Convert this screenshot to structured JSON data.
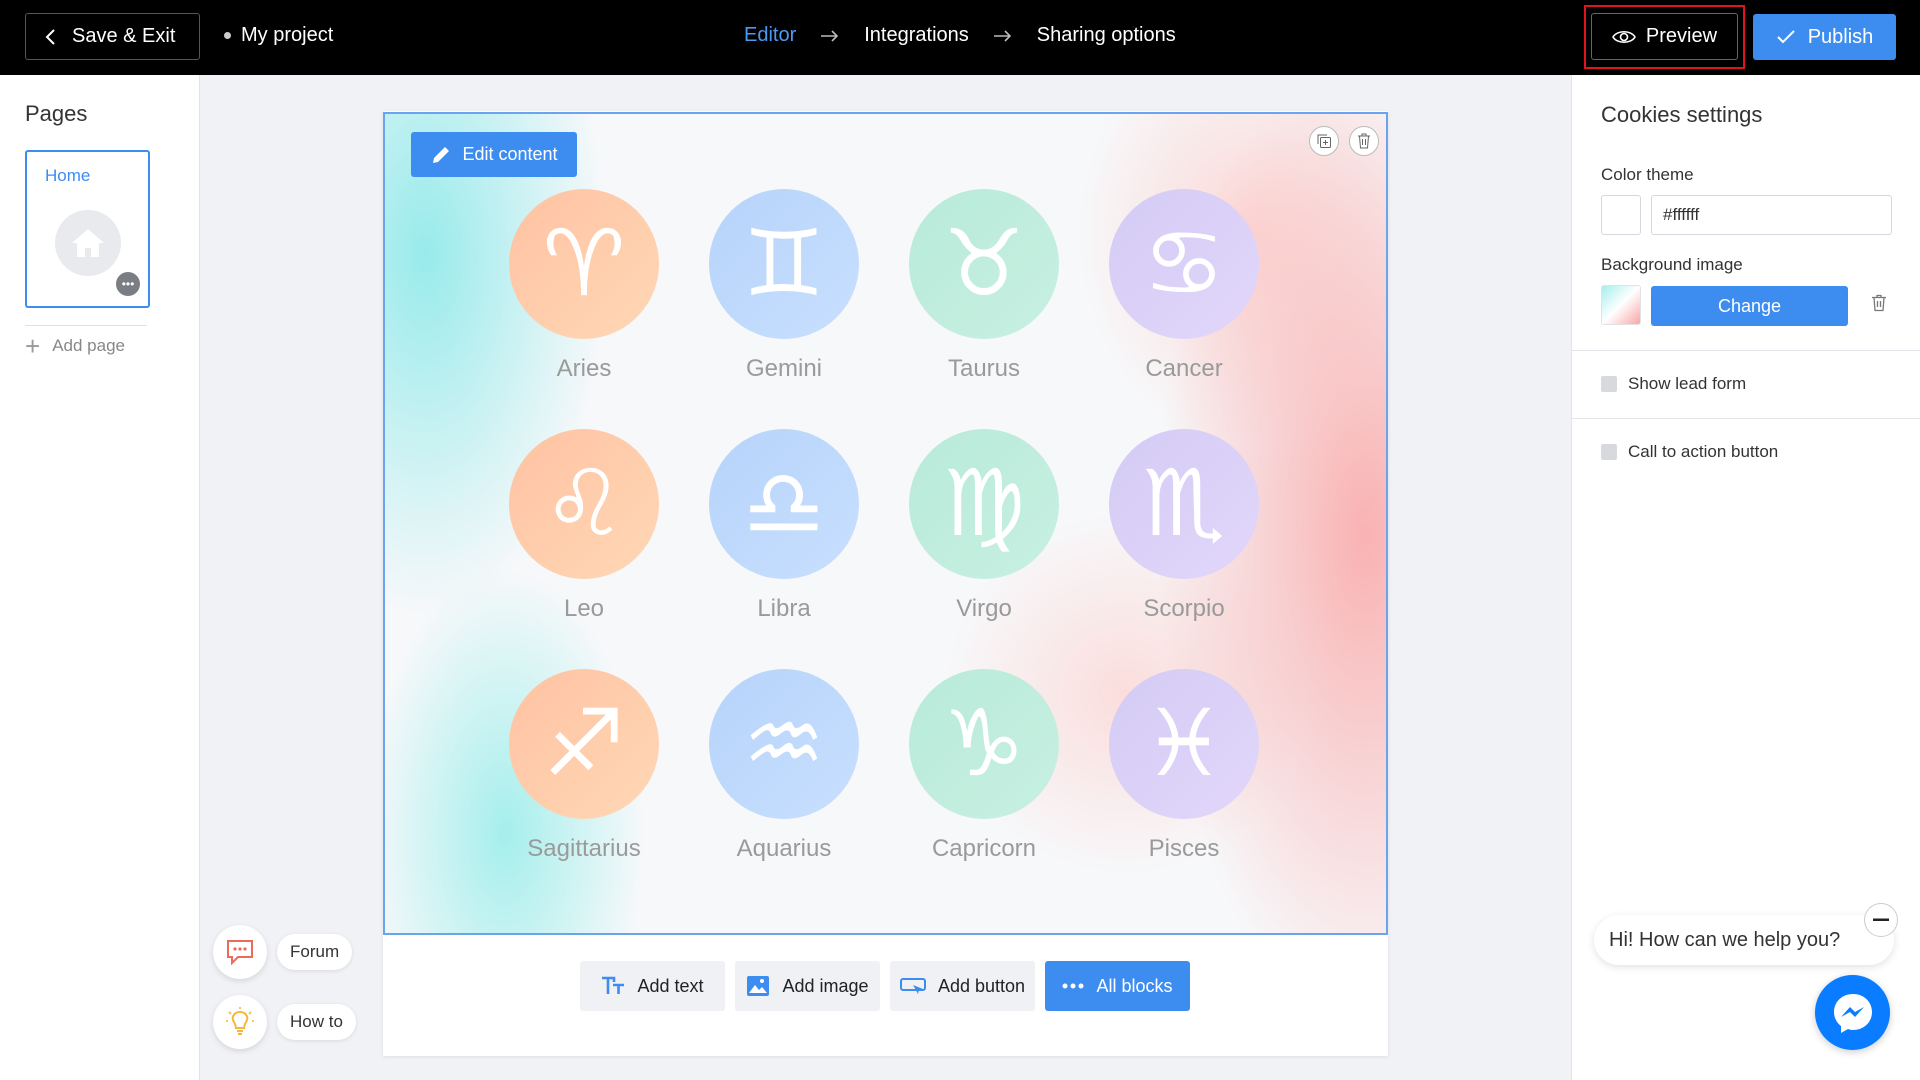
{
  "topbar": {
    "save_exit_label": "Save & Exit",
    "project_name": "My project",
    "steps": [
      "Editor",
      "Integrations",
      "Sharing options"
    ],
    "preview_label": "Preview",
    "publish_label": "Publish"
  },
  "pages": {
    "title": "Pages",
    "items": [
      {
        "label": "Home"
      }
    ],
    "add_page_label": "Add page"
  },
  "help": {
    "forum_label": "Forum",
    "howto_label": "How to"
  },
  "canvas": {
    "edit_content_label": "Edit content",
    "signs": [
      {
        "name": "Aries",
        "glyph": "♈",
        "color": "orange"
      },
      {
        "name": "Gemini",
        "glyph": "♊",
        "color": "blue"
      },
      {
        "name": "Taurus",
        "glyph": "♉",
        "color": "green"
      },
      {
        "name": "Cancer",
        "glyph": "♋",
        "color": "purple"
      },
      {
        "name": "Leo",
        "glyph": "♌",
        "color": "orange"
      },
      {
        "name": "Libra",
        "glyph": "♎",
        "color": "blue"
      },
      {
        "name": "Virgo",
        "glyph": "♍",
        "color": "green"
      },
      {
        "name": "Scorpio",
        "glyph": "♏",
        "color": "purple"
      },
      {
        "name": "Sagittarius",
        "glyph": "♐",
        "color": "orange"
      },
      {
        "name": "Aquarius",
        "glyph": "♒",
        "color": "blue"
      },
      {
        "name": "Capricorn",
        "glyph": "♑",
        "color": "green"
      },
      {
        "name": "Pisces",
        "glyph": "♓",
        "color": "purple"
      }
    ]
  },
  "add_bar": {
    "add_text": "Add text",
    "add_image": "Add image",
    "add_button": "Add button",
    "all_blocks": "All blocks"
  },
  "settings": {
    "title": "Cookies settings",
    "color_theme_label": "Color theme",
    "color_theme_value": "#ffffff",
    "background_image_label": "Background image",
    "change_label": "Change",
    "show_lead_form_label": "Show lead form",
    "cta_button_label": "Call to action button"
  },
  "chat": {
    "message": "Hi! How can we help you?"
  },
  "colors": {
    "accent": "#3d8df0",
    "topbar_bg": "#000000",
    "highlight": "#e0141e"
  }
}
